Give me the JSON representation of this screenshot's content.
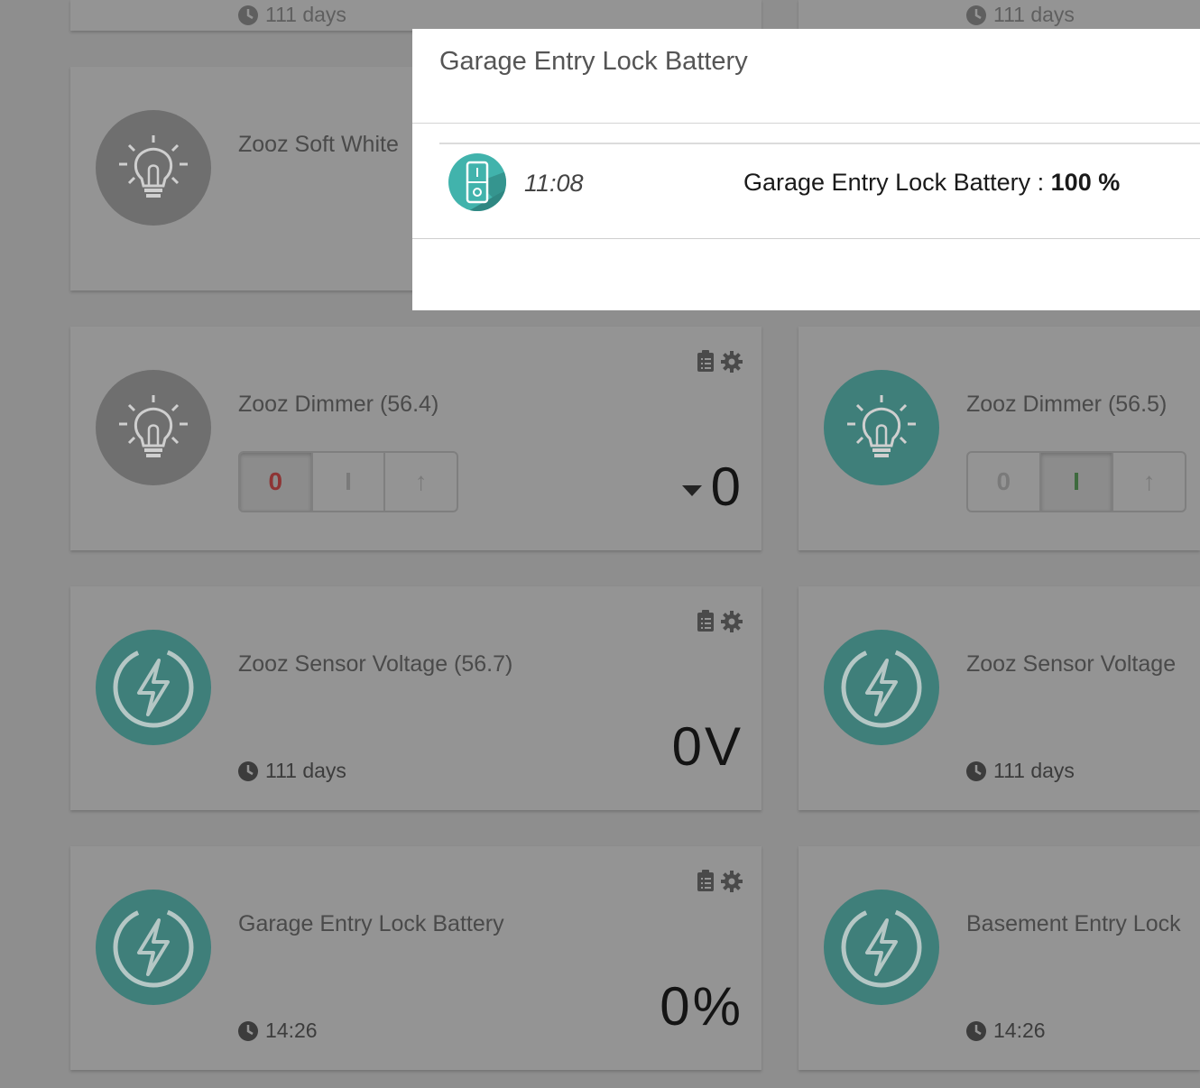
{
  "colors": {
    "overlay_bg": "#8e8e8e",
    "card_bg": "#969696",
    "teal": "#3f7f7a",
    "modal_icon_teal": "#41b3ac"
  },
  "top_partial": [
    "111 days",
    "111 days"
  ],
  "cards": [
    {
      "title": "Zooz Soft White",
      "icon": "lightbulb-icon"
    },
    {
      "title": "Zooz Dimmer (56.4)",
      "icon": "lightbulb-icon",
      "switch": [
        "0",
        "I",
        "↑"
      ],
      "active": 0,
      "value": "0"
    },
    {
      "title": "Zooz Dimmer (56.5)",
      "icon": "lightbulb-icon",
      "switch": [
        "0",
        "I",
        "↑"
      ],
      "active": 1
    },
    {
      "title": "Zooz Sensor Voltage (56.7)",
      "icon": "bolt-icon",
      "footer": "111 days",
      "value": "0V"
    },
    {
      "title": "Zooz Sensor Voltage",
      "icon": "bolt-icon",
      "footer": "111 days"
    },
    {
      "title": "Garage Entry Lock Battery",
      "icon": "bolt-icon",
      "footer": "14:26",
      "value": "0%"
    },
    {
      "title": "Basement Entry Lock",
      "icon": "bolt-icon",
      "footer": "14:26"
    }
  ],
  "modal": {
    "title": "Garage Entry Lock Battery",
    "log": {
      "icon": "switch-icon",
      "time": "11:08",
      "label": "Garage Entry Lock Battery : ",
      "value": "100 %"
    }
  }
}
